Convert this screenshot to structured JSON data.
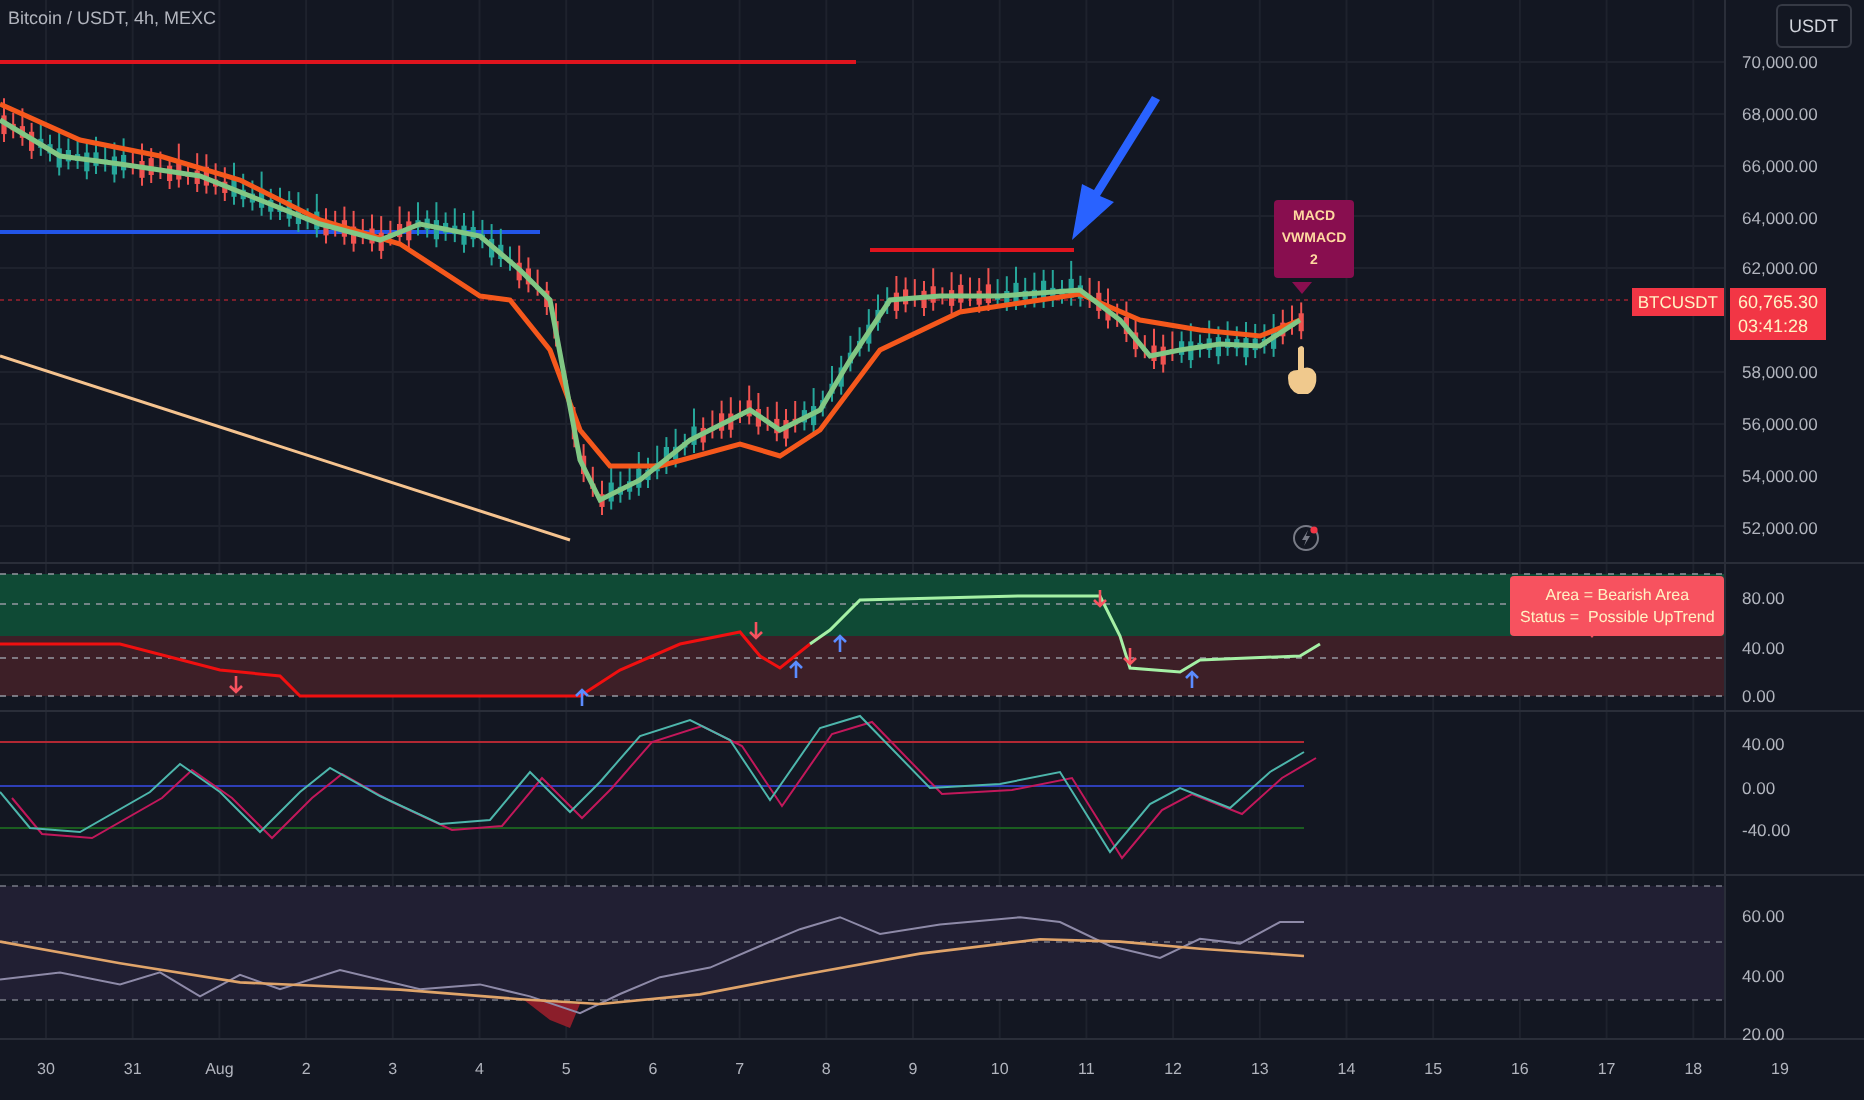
{
  "chart_header": {
    "symbol_title": "Bitcoin / USDT, 4h, MEXC"
  },
  "currency_button": "USDT",
  "price_axis": {
    "ticks": [
      "70,000.00",
      "68,000.00",
      "66,000.00",
      "64,000.00",
      "62,000.00",
      "58,000.00",
      "56,000.00",
      "54,000.00",
      "52,000.00"
    ],
    "symbol_label": "BTCUSDT",
    "last_price": "60,765.30",
    "countdown": "03:41:28"
  },
  "callout": {
    "lines": [
      "MACD",
      "VWMACD",
      "2"
    ]
  },
  "indicator_panes": [
    {
      "ticks": [
        "80.00",
        "40.00",
        "0.00"
      ],
      "tooltip": [
        "Area = Bearish Area",
        "Status =  Possible UpTrend"
      ]
    },
    {
      "ticks": [
        "40.00",
        "0.00",
        "-40.00"
      ]
    },
    {
      "ticks": [
        "60.00",
        "40.00",
        "20.00"
      ]
    }
  ],
  "time_axis": [
    "30",
    "31",
    "Aug",
    "2",
    "3",
    "4",
    "5",
    "6",
    "7",
    "8",
    "9",
    "10",
    "11",
    "12",
    "13",
    "14",
    "15",
    "16",
    "17",
    "18",
    "19"
  ]
}
